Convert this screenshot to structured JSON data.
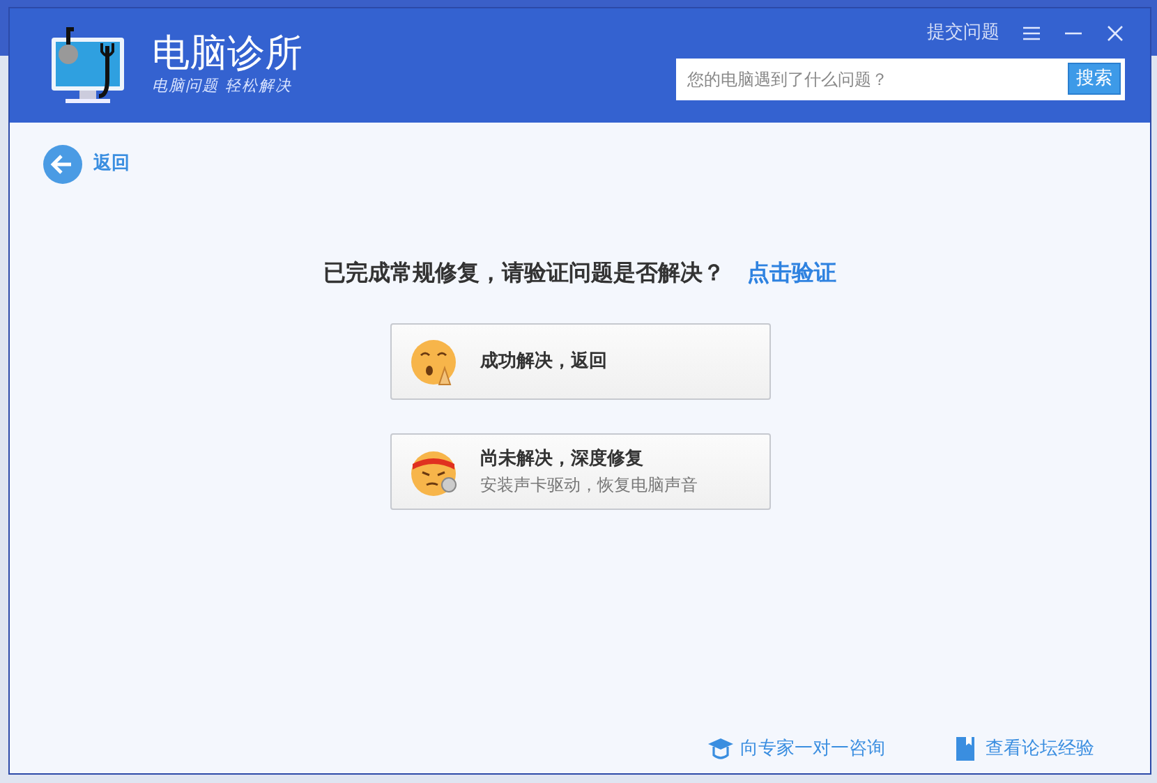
{
  "window": {
    "title": "电脑诊所",
    "subtitle": "电脑问题 轻松解决",
    "header_links": [
      {
        "kind": "text",
        "label": "提交问题"
      },
      {
        "kind": "menu"
      },
      {
        "kind": "minimize"
      },
      {
        "kind": "close"
      }
    ]
  },
  "search": {
    "placeholder": "您的电脑遇到了什么问题？",
    "button": "搜索"
  },
  "back": {
    "label": "返回"
  },
  "prompt": {
    "text": "已完成常规修复，请验证问题是否解决？",
    "link": "点击验证"
  },
  "options": [
    {
      "kind": "happy",
      "title": "成功解决，返回"
    },
    {
      "kind": "repair",
      "title": "尚未解决，深度修复",
      "subtitle": "安装声卡驱动，恢复电脑声音"
    }
  ],
  "footer_links": [
    {
      "kind": "expert",
      "label": "向专家一对一咨询"
    },
    {
      "kind": "forum",
      "label": "查看论坛经验"
    }
  ]
}
